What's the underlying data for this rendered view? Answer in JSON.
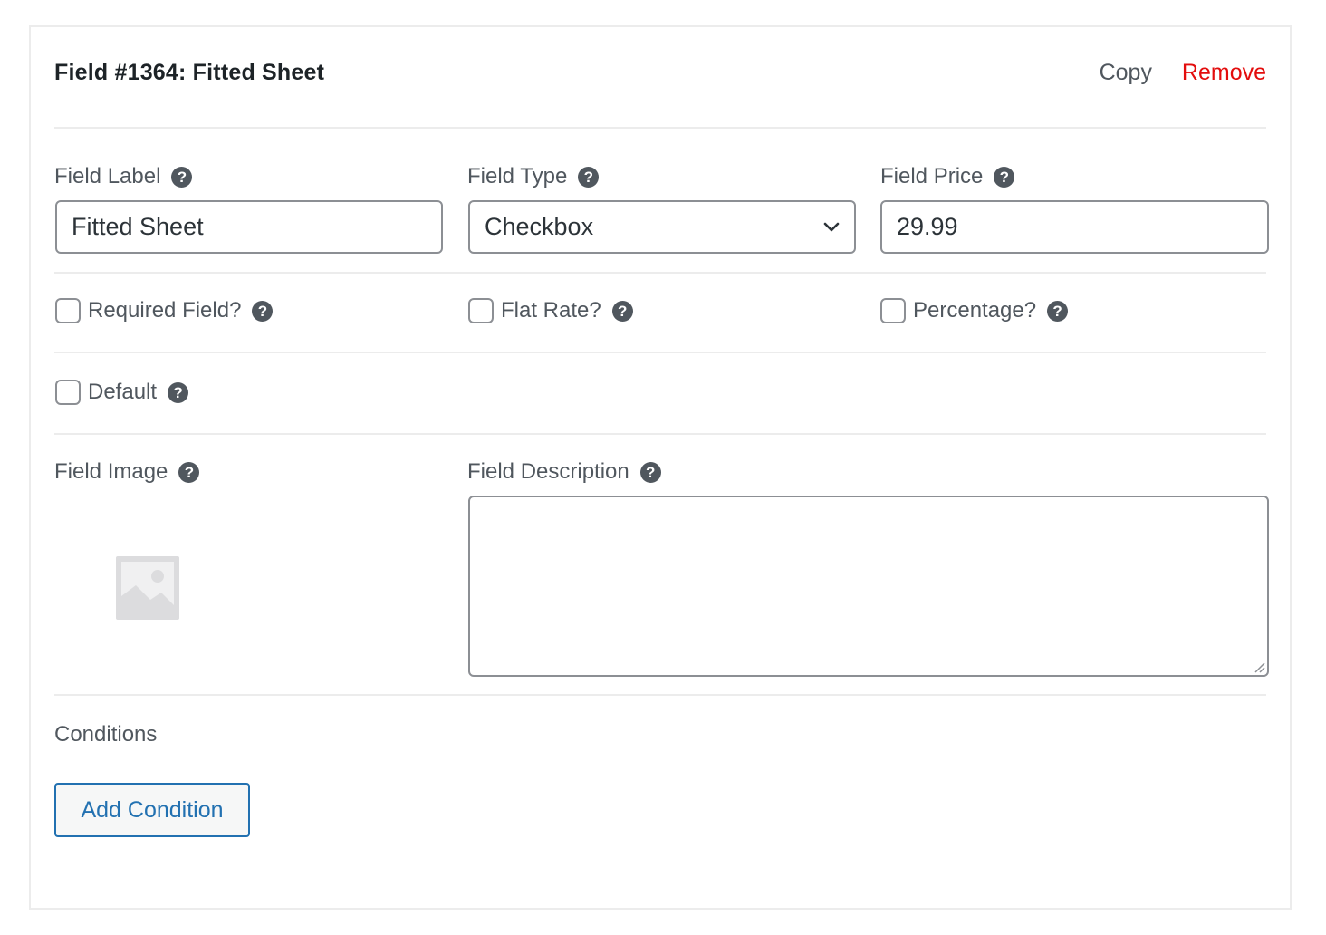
{
  "header": {
    "title": "Field #1364: Fitted Sheet",
    "copy_label": "Copy",
    "remove_label": "Remove"
  },
  "fields": {
    "label": {
      "label": "Field Label",
      "value": "Fitted Sheet"
    },
    "type": {
      "label": "Field Type",
      "value": "Checkbox"
    },
    "price": {
      "label": "Field Price",
      "value": "29.99"
    }
  },
  "options": {
    "required": {
      "label": "Required Field?",
      "checked": false
    },
    "flat_rate": {
      "label": "Flat Rate?",
      "checked": false
    },
    "percentage": {
      "label": "Percentage?",
      "checked": false
    },
    "default": {
      "label": "Default",
      "checked": false
    }
  },
  "image": {
    "label": "Field Image"
  },
  "description": {
    "label": "Field Description",
    "value": ""
  },
  "conditions": {
    "label": "Conditions",
    "add_label": "Add Condition"
  },
  "icons": {
    "help": "question-circle-icon",
    "dropdown": "chevron-down-icon",
    "image_placeholder": "image-placeholder-icon"
  },
  "colors": {
    "remove": "#e30d0d",
    "accent": "#2271b1",
    "help_icon": "#50575e"
  }
}
